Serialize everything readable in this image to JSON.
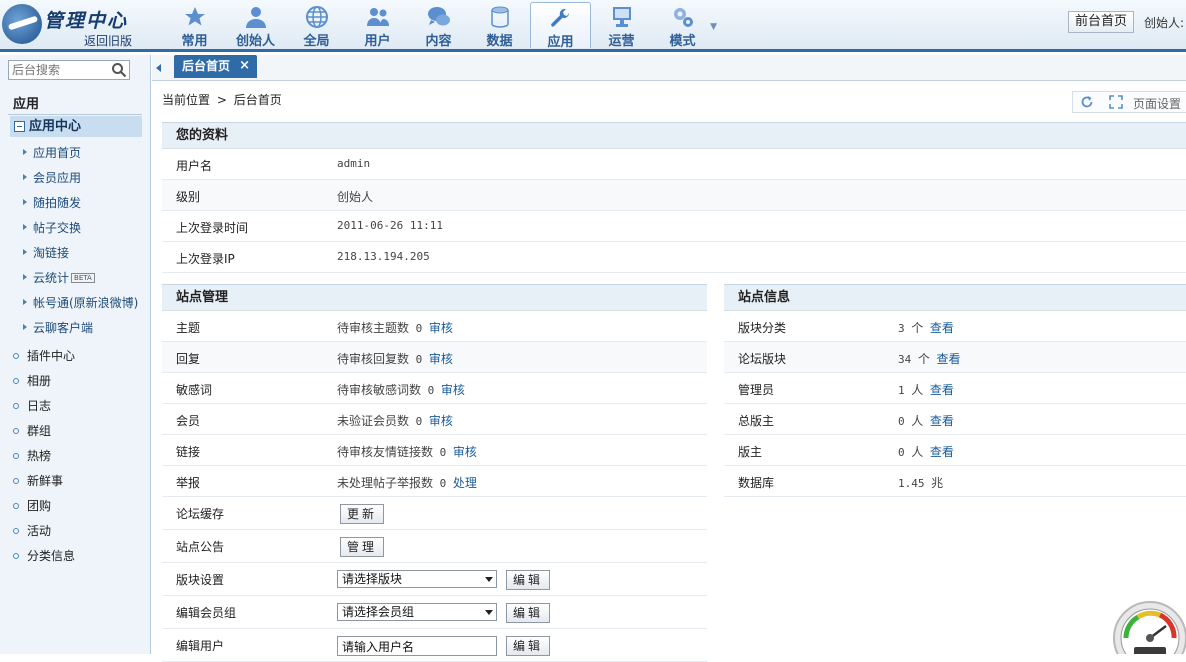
{
  "header": {
    "logo_title": "管理中心",
    "back_link": "返回旧版",
    "nav": [
      {
        "label": "常用",
        "icon": "star-icon"
      },
      {
        "label": "创始人",
        "icon": "person-icon"
      },
      {
        "label": "全局",
        "icon": "globe-icon"
      },
      {
        "label": "用户",
        "icon": "users-icon"
      },
      {
        "label": "内容",
        "icon": "chat-bubbles-icon"
      },
      {
        "label": "数据",
        "icon": "database-icon"
      },
      {
        "label": "应用",
        "icon": "wrench-icon",
        "active": true
      },
      {
        "label": "运营",
        "icon": "monitor-icon"
      },
      {
        "label": "模式",
        "icon": "gears-icon"
      }
    ],
    "front_home": "前台首页",
    "founder_label": "创始人:"
  },
  "sidebar": {
    "search_placeholder": "后台搜索",
    "section_title": "应用",
    "group_label": "应用中心",
    "sub_items": [
      "应用首页",
      "会员应用",
      "随拍随发",
      "帖子交换",
      "淘链接",
      "云统计",
      "帐号通(原新浪微博)",
      "云聊客户端"
    ],
    "beta_badge": "BETA",
    "items": [
      "插件中心",
      "相册",
      "日志",
      "群组",
      "热榜",
      "新鲜事",
      "团购",
      "活动",
      "分类信息"
    ]
  },
  "tabs": {
    "home_tab": "后台首页",
    "close_glyph": "×"
  },
  "breadcrumb": {
    "prefix": "当前位置",
    "separator": ">",
    "current": "后台首页"
  },
  "page_tools": {
    "settings_label": "页面设置"
  },
  "profile": {
    "title": "您的资料",
    "rows": [
      {
        "key": "用户名",
        "value": "admin"
      },
      {
        "key": "级别",
        "value": "创始人"
      },
      {
        "key": "上次登录时间",
        "value": "2011-06-26 11:11"
      },
      {
        "key": "上次登录IP",
        "value": "218.13.194.205"
      }
    ]
  },
  "site_manage": {
    "title": "站点管理",
    "rows": [
      {
        "key": "主题",
        "text": "待审核主题数",
        "count": "0",
        "link": "审核"
      },
      {
        "key": "回复",
        "text": "待审核回复数",
        "count": "0",
        "link": "审核"
      },
      {
        "key": "敏感词",
        "text": "待审核敏感词数",
        "count": "0",
        "link": "审核"
      },
      {
        "key": "会员",
        "text": "未验证会员数",
        "count": "0",
        "link": "审核"
      },
      {
        "key": "链接",
        "text": "待审核友情链接数",
        "count": "0",
        "link": "审核"
      },
      {
        "key": "举报",
        "text": "未处理帖子举报数",
        "count": "0",
        "link": "处理"
      }
    ],
    "cache_key": "论坛缓存",
    "cache_button": "更新",
    "notice_key": "站点公告",
    "notice_button": "管理",
    "forum_key": "版块设置",
    "forum_select": "请选择版块",
    "group_key": "编辑会员组",
    "group_select": "请选择会员组",
    "user_key": "编辑用户",
    "user_placeholder": "请输入用户名",
    "edit_button": "编辑"
  },
  "site_info": {
    "title": "站点信息",
    "rows": [
      {
        "key": "版块分类",
        "count": "3",
        "unit": "个",
        "link": "查看"
      },
      {
        "key": "论坛版块",
        "count": "34",
        "unit": "个",
        "link": "查看"
      },
      {
        "key": "管理员",
        "count": "1",
        "unit": "人",
        "link": "查看"
      },
      {
        "key": "总版主",
        "count": "0",
        "unit": "人",
        "link": "查看"
      },
      {
        "key": "版主",
        "count": "0",
        "unit": "人",
        "link": "查看"
      },
      {
        "key": "数据库",
        "count": "1.45",
        "unit": "兆",
        "link": ""
      }
    ]
  }
}
